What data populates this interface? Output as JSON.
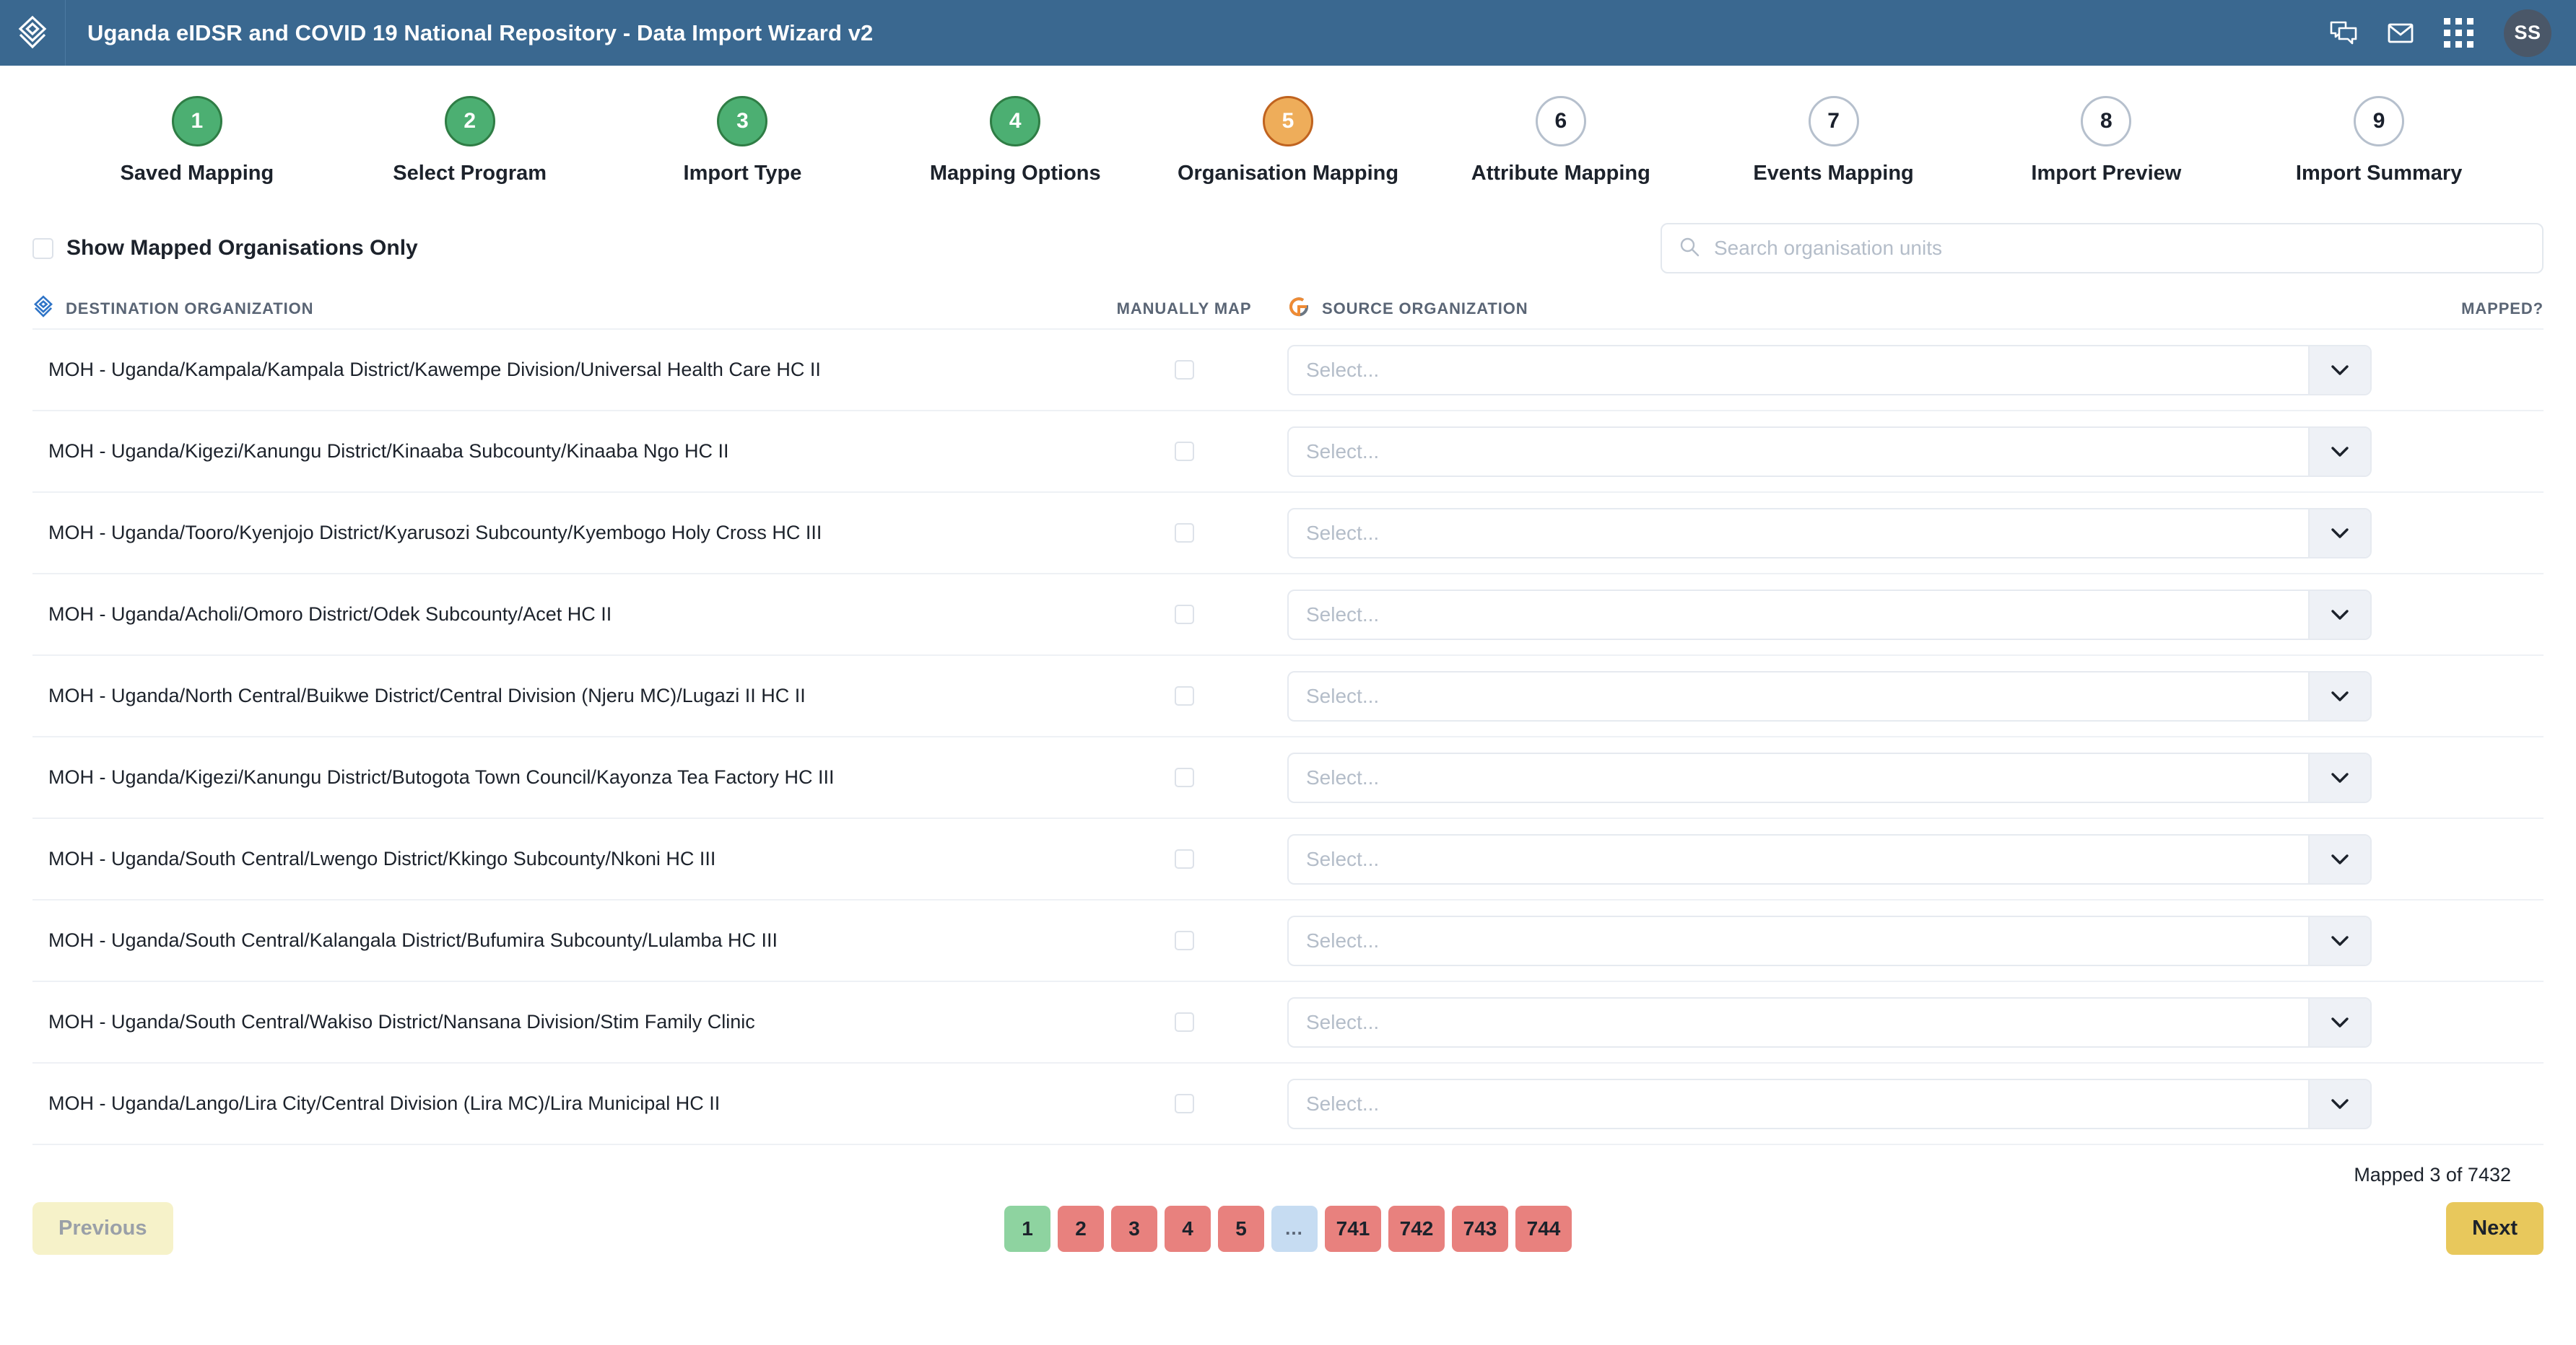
{
  "header": {
    "title": "Uganda eIDSR and COVID 19 National Repository - Data Import Wizard v2",
    "logo_icon": "dhis2-diamond-logo",
    "icons": [
      {
        "name": "messages-icon",
        "glyph": "chat-bubbles"
      },
      {
        "name": "mail-icon",
        "glyph": "envelope"
      },
      {
        "name": "apps-grid-icon",
        "glyph": "nine-dot-grid"
      }
    ],
    "avatar_initials": "SS",
    "bg_color": "#3a6890",
    "avatar_color": "#4a5768"
  },
  "stepper": {
    "current": 5,
    "colors": {
      "done_fill": "#4caf72",
      "done_border": "#2f7d45",
      "active_fill": "#eead5a",
      "active_border": "#c0631f",
      "todo_border": "#b6c0cd"
    },
    "steps": [
      {
        "number": "1",
        "label": "Saved Mapping",
        "state": "done"
      },
      {
        "number": "2",
        "label": "Select Program",
        "state": "done"
      },
      {
        "number": "3",
        "label": "Import Type",
        "state": "done"
      },
      {
        "number": "4",
        "label": "Mapping Options",
        "state": "done"
      },
      {
        "number": "5",
        "label": "Organisation Mapping",
        "state": "active"
      },
      {
        "number": "6",
        "label": "Attribute Mapping",
        "state": "todo"
      },
      {
        "number": "7",
        "label": "Events Mapping",
        "state": "todo"
      },
      {
        "number": "8",
        "label": "Import Preview",
        "state": "todo"
      },
      {
        "number": "9",
        "label": "Import Summary",
        "state": "todo"
      }
    ]
  },
  "controls": {
    "show_mapped_only_label": "Show Mapped Organisations Only",
    "show_mapped_only_checked": false,
    "search_placeholder": "Search organisation units",
    "search_value": ""
  },
  "table": {
    "headers": {
      "destination": "DESTINATION ORGANIZATION",
      "manually_map": "MANUALLY MAP",
      "source": "SOURCE ORGANIZATION",
      "mapped": "MAPPED?"
    },
    "destination_icon": "dhis2-diamond-logo",
    "source_icon": "godata-g-logo",
    "select_placeholder": "Select...",
    "rows": [
      {
        "destination": "MOH - Uganda/Kampala/Kampala District/Kawempe Division/Universal Health Care HC II",
        "manually_map": false,
        "source": "",
        "mapped": ""
      },
      {
        "destination": "MOH - Uganda/Kigezi/Kanungu District/Kinaaba Subcounty/Kinaaba Ngo HC II",
        "manually_map": false,
        "source": "",
        "mapped": ""
      },
      {
        "destination": "MOH - Uganda/Tooro/Kyenjojo District/Kyarusozi Subcounty/Kyembogo Holy Cross HC III",
        "manually_map": false,
        "source": "",
        "mapped": ""
      },
      {
        "destination": "MOH - Uganda/Acholi/Omoro District/Odek Subcounty/Acet HC II",
        "manually_map": false,
        "source": "",
        "mapped": ""
      },
      {
        "destination": "MOH - Uganda/North Central/Buikwe District/Central Division (Njeru MC)/Lugazi II HC II",
        "manually_map": false,
        "source": "",
        "mapped": ""
      },
      {
        "destination": "MOH - Uganda/Kigezi/Kanungu District/Butogota Town Council/Kayonza Tea Factory HC III",
        "manually_map": false,
        "source": "",
        "mapped": ""
      },
      {
        "destination": "MOH - Uganda/South Central/Lwengo District/Kkingo Subcounty/Nkoni HC III",
        "manually_map": false,
        "source": "",
        "mapped": ""
      },
      {
        "destination": "MOH - Uganda/South Central/Kalangala District/Bufumira Subcounty/Lulamba HC III",
        "manually_map": false,
        "source": "",
        "mapped": ""
      },
      {
        "destination": "MOH - Uganda/South Central/Wakiso District/Nansana Division/Stim Family Clinic",
        "manually_map": false,
        "source": "",
        "mapped": ""
      },
      {
        "destination": "MOH - Uganda/Lango/Lira City/Central Division (Lira MC)/Lira Municipal HC II",
        "manually_map": false,
        "source": "",
        "mapped": ""
      }
    ],
    "mapped_count_text": "Mapped 3 of 7432"
  },
  "footer": {
    "previous_label": "Previous",
    "next_label": "Next",
    "previous_disabled": true,
    "pagination": [
      {
        "label": "1",
        "state": "active"
      },
      {
        "label": "2",
        "state": "normal"
      },
      {
        "label": "3",
        "state": "normal"
      },
      {
        "label": "4",
        "state": "normal"
      },
      {
        "label": "5",
        "state": "normal"
      },
      {
        "label": "…",
        "state": "dots"
      },
      {
        "label": "741",
        "state": "normal"
      },
      {
        "label": "742",
        "state": "normal"
      },
      {
        "label": "743",
        "state": "normal"
      },
      {
        "label": "744",
        "state": "normal"
      }
    ],
    "colors": {
      "page_active": "#8ed3a0",
      "page_normal": "#e8817e",
      "page_dots": "#c6dcf2",
      "next_bg": "#e8c85c",
      "prev_bg": "#f6f2c9"
    }
  }
}
